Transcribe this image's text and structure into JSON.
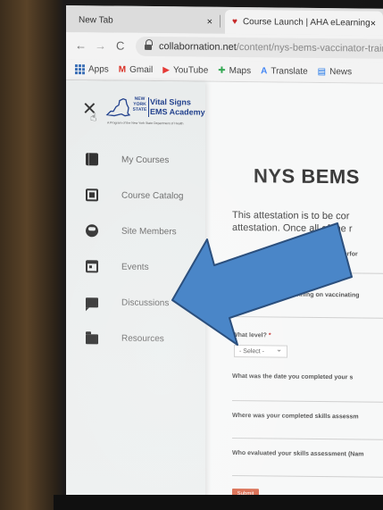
{
  "tabs": [
    {
      "label": "New Tab",
      "close": "×"
    },
    {
      "label": "Course Launch | AHA eLearning",
      "close": "×"
    }
  ],
  "toolbar": {
    "back": "←",
    "forward": "→",
    "reload": "C",
    "url_host": "collabornation.net",
    "url_path": "/content/nys-bems-vaccinator-traini"
  },
  "bookmarks": [
    {
      "label": "Apps",
      "icon": "apps-grid-icon"
    },
    {
      "label": "Gmail",
      "icon": "gmail-icon",
      "glyph": "M",
      "color": "#d93025"
    },
    {
      "label": "YouTube",
      "icon": "youtube-icon",
      "glyph": "▶",
      "color": "#e53935"
    },
    {
      "label": "Maps",
      "icon": "maps-icon",
      "glyph": "✚",
      "color": "#34a853"
    },
    {
      "label": "Translate",
      "icon": "translate-icon",
      "glyph": "A",
      "color": "#4285f4"
    },
    {
      "label": "News",
      "icon": "news-icon",
      "glyph": "▤",
      "color": "#1a73e8"
    }
  ],
  "drawer": {
    "close": "✕",
    "logo": {
      "state_text": "NEW YORK STATE",
      "title_line1": "Vital Signs",
      "title_line2": "EMS Academy",
      "tagline": "A Program of the New York State Department of Health"
    },
    "items": [
      {
        "label": "My Courses",
        "icon": "courses-book-icon"
      },
      {
        "label": "Course Catalog",
        "icon": "catalog-icon"
      },
      {
        "label": "Site Members",
        "icon": "members-icon"
      },
      {
        "label": "Events",
        "icon": "calendar-icon"
      },
      {
        "label": "Discussions",
        "icon": "discussion-icon"
      },
      {
        "label": "Resources",
        "icon": "folder-icon"
      }
    ]
  },
  "main": {
    "title": "NYS BEMS",
    "intro_line1": "This attestation is to be cor",
    "intro_line2": "attestation. Once all of the r",
    "q1_partial": "on perfor",
    "q2": "you planning on vaccinating",
    "level_label": "What level?",
    "required_mark": "*",
    "level_select": "- Select -",
    "q3": "What was the date you completed your s",
    "q4": "Where was your completed skills assessm",
    "q5": "Who evaluated your skills assessment (Nam",
    "submit": "Submit"
  },
  "colors": {
    "arrow_fill": "#4a86c8",
    "arrow_stroke": "#2b4f7d",
    "logo_blue": "#1c3c8a",
    "submit": "#d96b4f"
  }
}
